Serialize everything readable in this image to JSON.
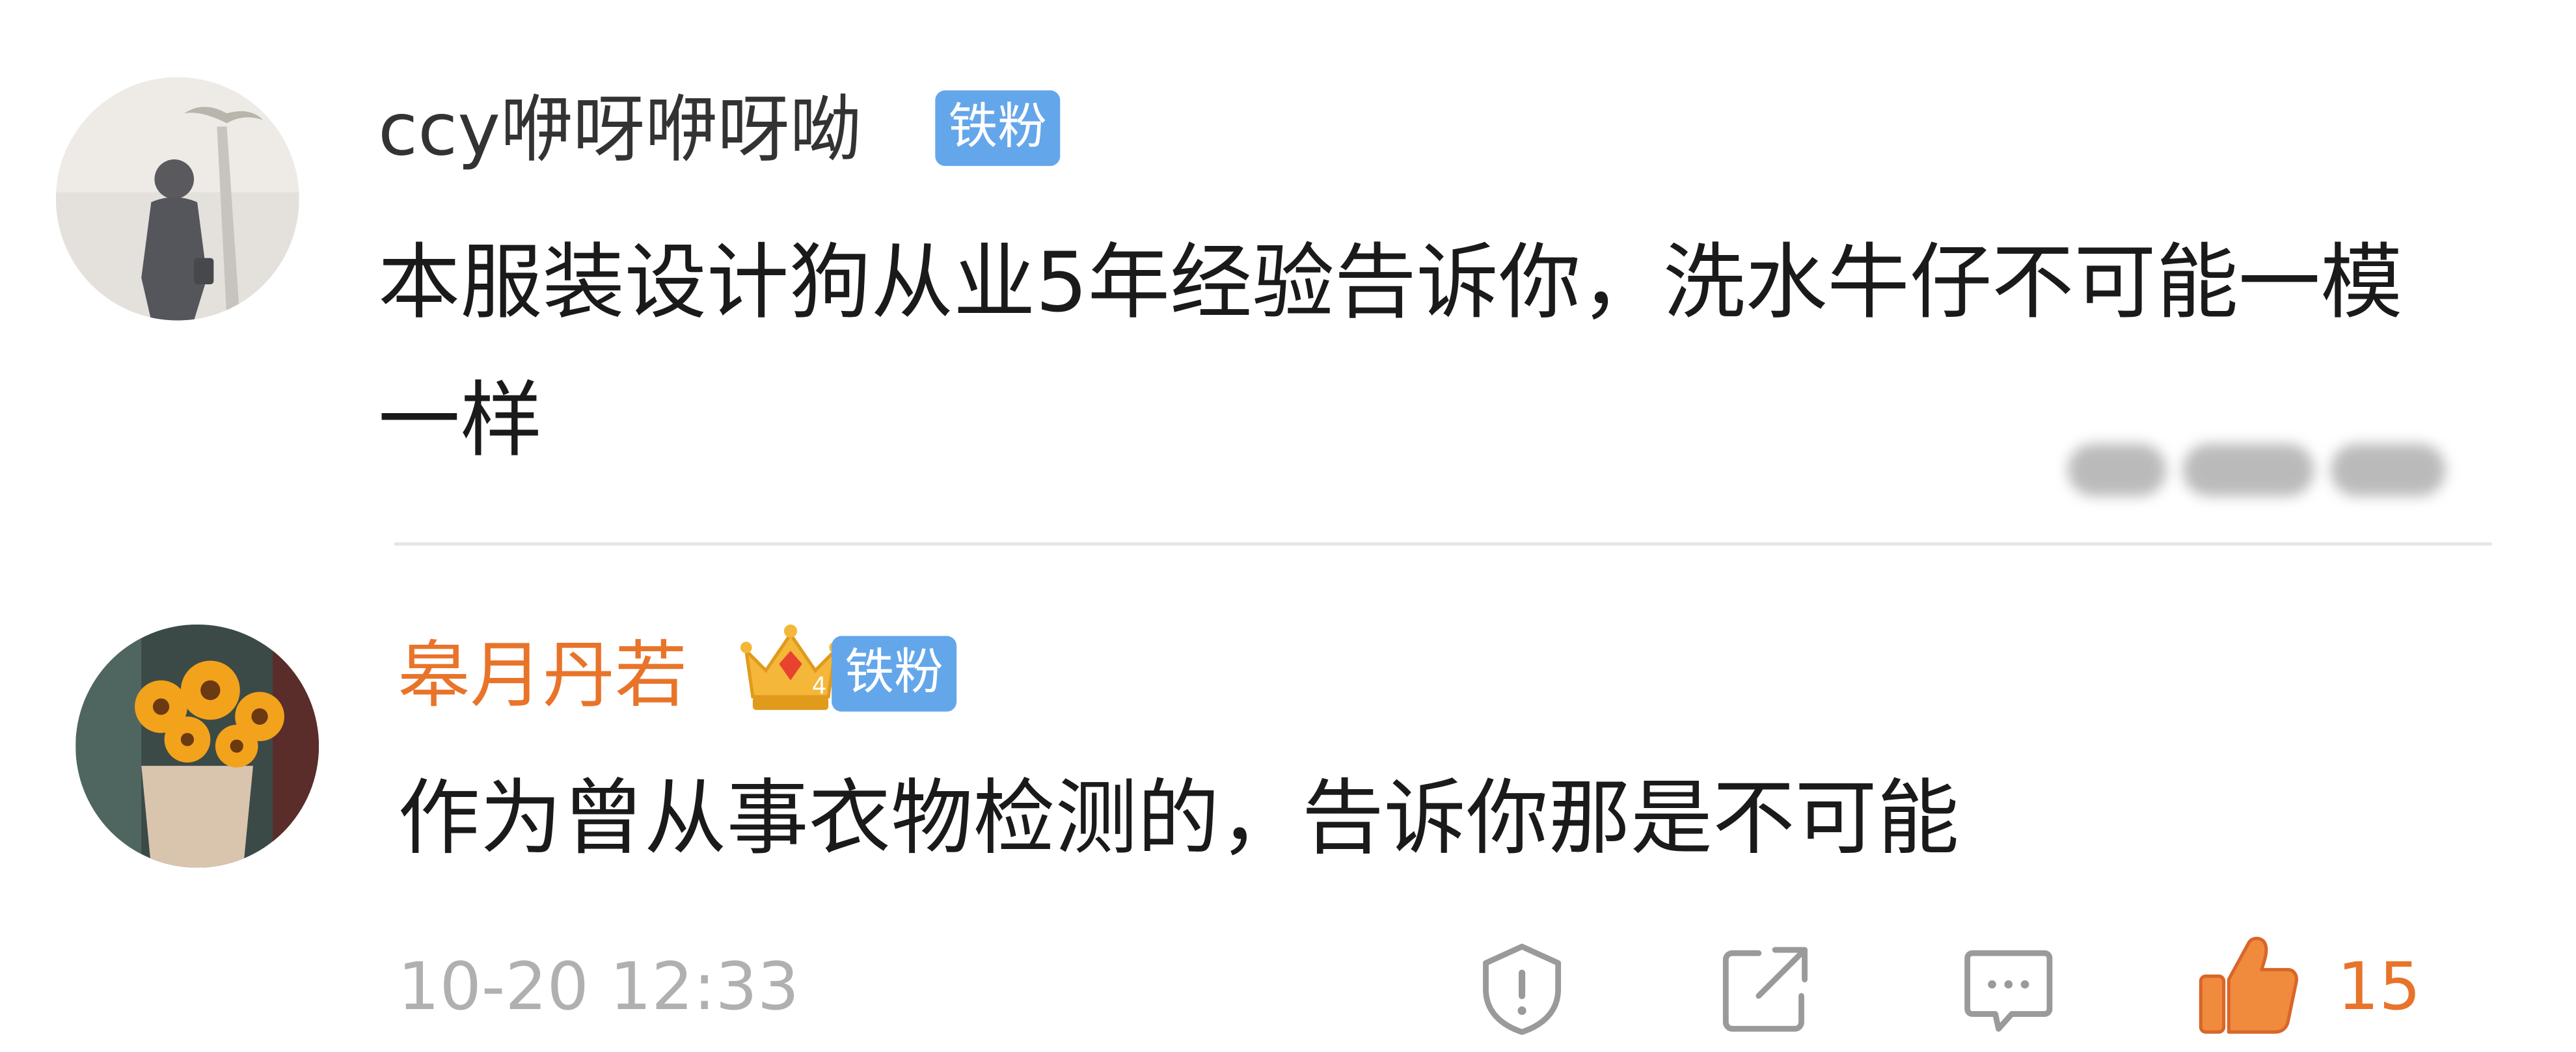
{
  "comments": [
    {
      "username": "ccy咿呀咿呀呦",
      "badge": "铁粉",
      "text": "本服装设计狗从业5年经验告诉你，洗水牛仔不可能一模一样",
      "blurred_tag_icon": "blurred-emoji-tag",
      "avatar_icon": "silhouette-avatar"
    },
    {
      "username": "皋月丹若",
      "badge": "铁粉",
      "crown_level": "4",
      "text": "作为曾从事衣物检测的，告诉你那是不可能",
      "avatar_icon": "sunflower-avatar"
    }
  ],
  "footer": {
    "timestamp": "10-20 12:33",
    "like_count": "15",
    "icons": [
      "report-icon",
      "share-icon",
      "comment-icon",
      "like-icon"
    ]
  },
  "colors": {
    "username_primary": "#333333",
    "username_vip": "#e8742a",
    "badge_bg": "#64a6ea",
    "like_accent": "#e8742a",
    "muted": "#b0b0b0"
  }
}
